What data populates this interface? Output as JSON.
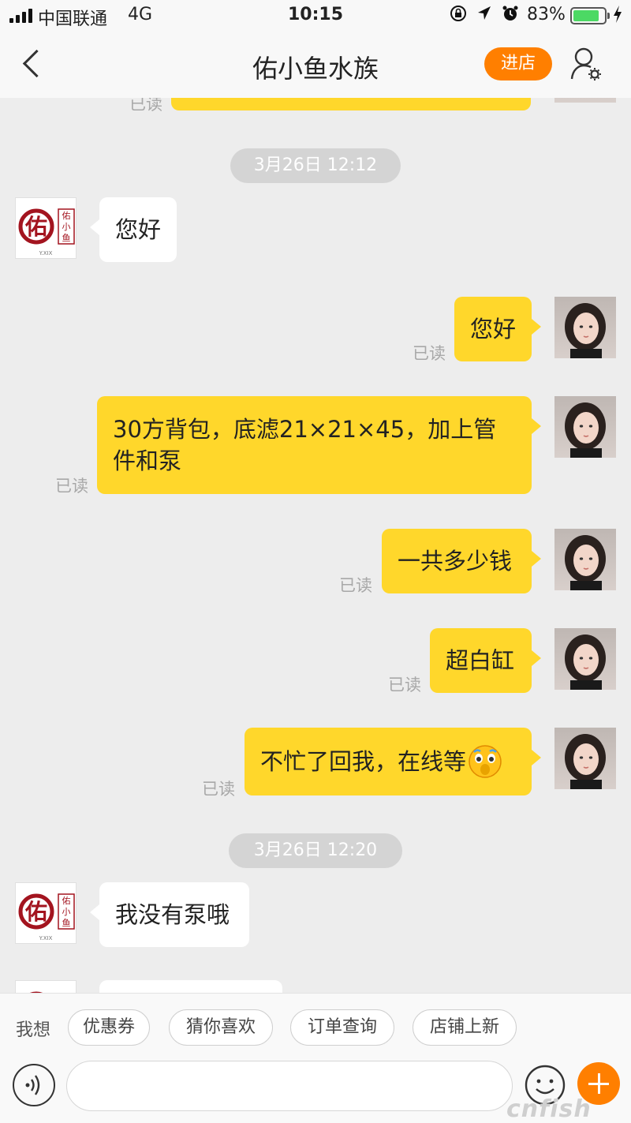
{
  "status_bar": {
    "carrier": "中国联通",
    "network": "4G",
    "time": "10:15",
    "battery": "83%"
  },
  "nav": {
    "title": "佑小鱼水族",
    "enter_label": "进店"
  },
  "shop_logo": {
    "main_char": "佑",
    "side_chars": "佑小鱼",
    "subtext": "Y.XIX"
  },
  "chat": {
    "top_read": "已读",
    "timestamps": [
      "3月26日 12:12",
      "3月26日 12:20"
    ],
    "messages": [
      {
        "from": "shop",
        "text": "您好"
      },
      {
        "from": "me",
        "text": "您好",
        "status": "已读"
      },
      {
        "from": "me",
        "text": "30方背包，底滤21×21×45，加上管件和泵",
        "status": "已读"
      },
      {
        "from": "me",
        "text": "一共多少钱",
        "status": "已读"
      },
      {
        "from": "me",
        "text": "超白缸",
        "status": "已读"
      },
      {
        "from": "me",
        "text": "不忙了回我，在线等",
        "status": "已读",
        "emoji": "crying-emoji"
      },
      {
        "from": "shop",
        "text": "我没有泵哦"
      }
    ]
  },
  "quick_replies": {
    "prefix": "我想",
    "chips": [
      "优惠券",
      "猜你喜欢",
      "订单查询",
      "店铺上新"
    ]
  },
  "input": {
    "placeholder": ""
  },
  "watermark": "cnfish",
  "colors": {
    "accent_orange": "#ff7f00",
    "bubble_yellow": "#ffd72b",
    "background": "#ededed"
  }
}
